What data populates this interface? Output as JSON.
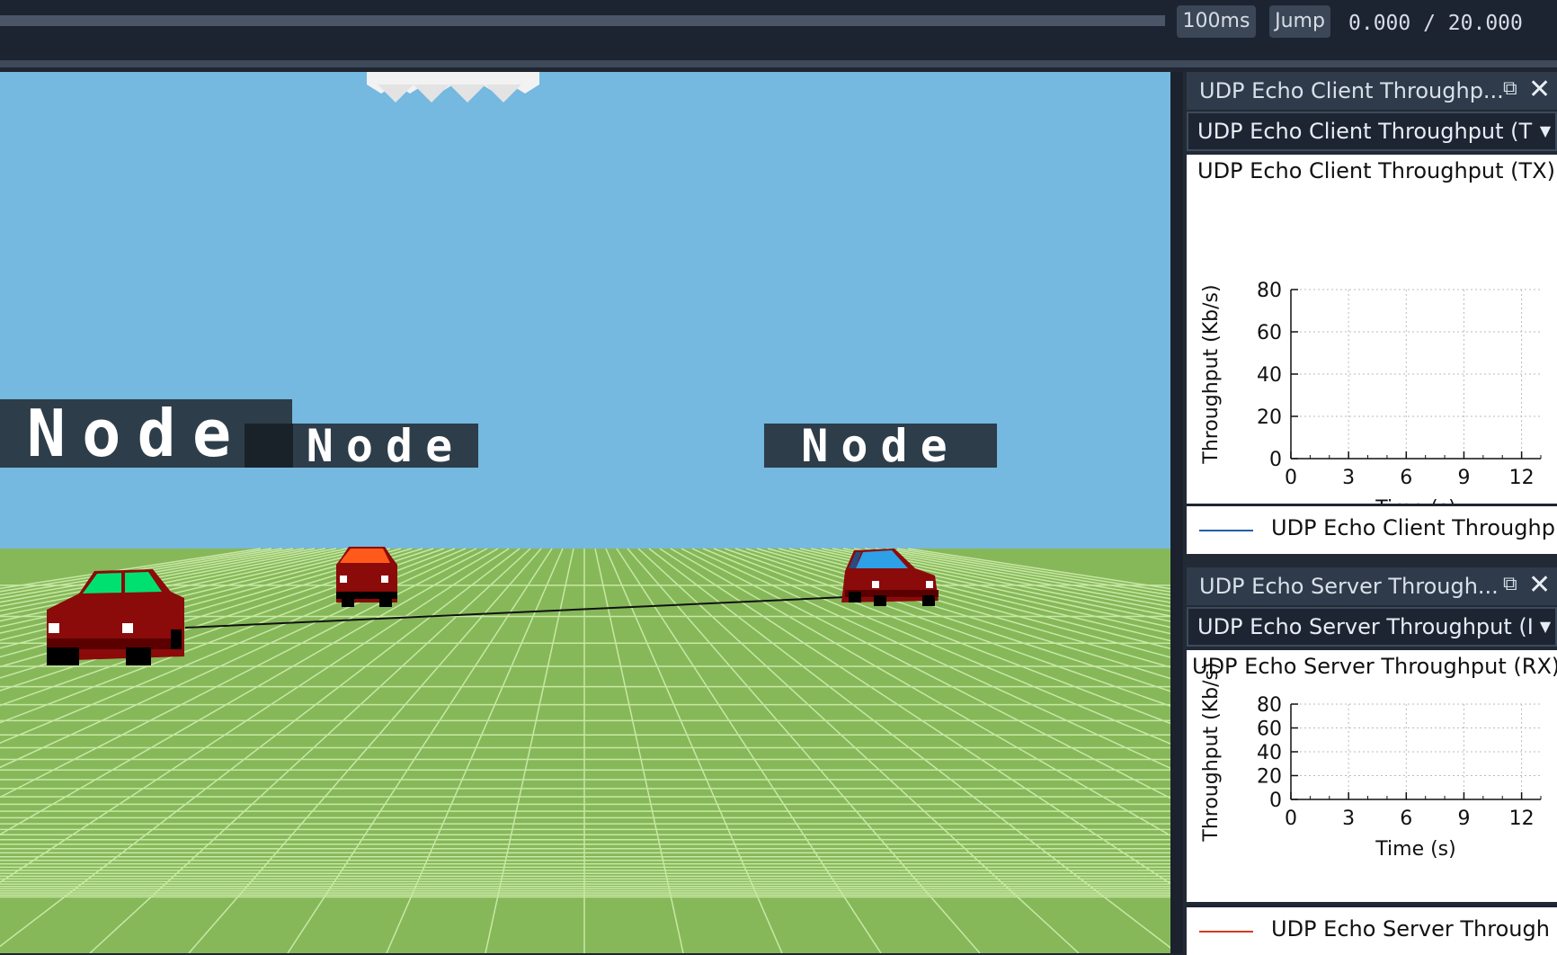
{
  "toolbar": {
    "speed_label": "100ms",
    "jump_label": "Jump",
    "time_current": "0.000",
    "time_separator": " / ",
    "time_total": "20.000"
  },
  "scene": {
    "node_labels": [
      "Node",
      "Node",
      "Node"
    ],
    "colors": {
      "sky": "#75b8e0",
      "ground": "#86b85a",
      "grid": "#c8e8a4",
      "link": "#111111"
    }
  },
  "panels": [
    {
      "title": "UDP Echo Client Throughp...",
      "selected_series": "UDP Echo Client Throughput (T",
      "legend": "UDP Echo Client Throughp",
      "legend_color": "#1f5faa",
      "chart_data": {
        "type": "line",
        "title": "UDP Echo Client Throughput (TX)",
        "xlabel": "Time (s)",
        "ylabel": "Throughput (Kb/s)",
        "xlim": [
          0,
          13
        ],
        "ylim": [
          0,
          80
        ],
        "x_ticks": [
          0,
          3,
          6,
          9,
          12
        ],
        "y_ticks": [
          0,
          20,
          40,
          60,
          80
        ],
        "grid": true,
        "series": [
          {
            "name": "UDP Echo Client Throughp",
            "x": [],
            "y": []
          }
        ]
      }
    },
    {
      "title": "UDP Echo Server Through...",
      "selected_series": "UDP Echo Server Throughput (I",
      "legend": "UDP Echo Server Through",
      "legend_color": "#d63a1a",
      "chart_data": {
        "type": "line",
        "title": "UDP Echo Server Throughput (RX)",
        "xlabel": "Time (s)",
        "ylabel": "Throughput (Kb/s)",
        "xlim": [
          0,
          13
        ],
        "ylim": [
          0,
          80
        ],
        "x_ticks": [
          0,
          3,
          6,
          9,
          12
        ],
        "y_ticks": [
          0,
          20,
          40,
          60,
          80
        ],
        "grid": true,
        "series": [
          {
            "name": "UDP Echo Server Through",
            "x": [],
            "y": []
          }
        ]
      }
    }
  ]
}
